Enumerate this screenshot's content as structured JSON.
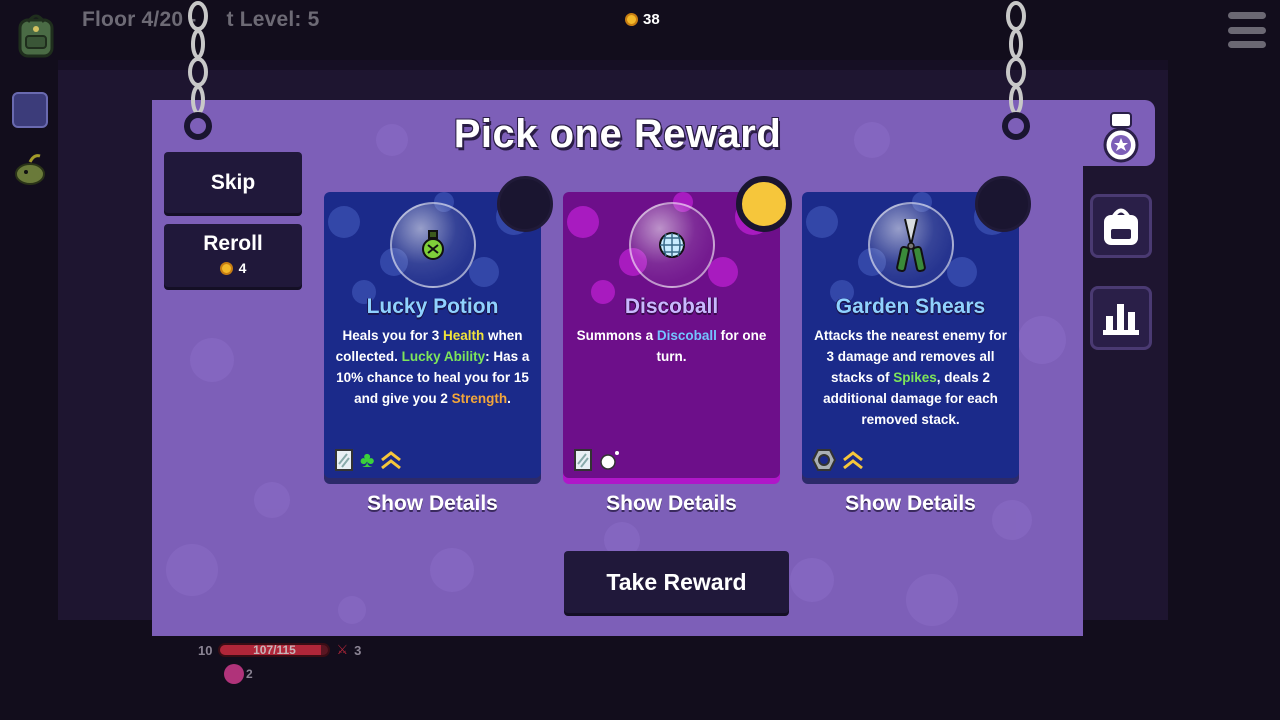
{
  "hud": {
    "floor_text": "Floor 4/20 - ",
    "level_text": "t Level: 5",
    "coins": "38",
    "hp_text": "107/115",
    "hp_fraction": 0.93,
    "shield": "10",
    "attack": "3",
    "skull_count": "2"
  },
  "panel": {
    "title": "Pick one Reward",
    "skip_label": "Skip",
    "reroll_label": "Reroll",
    "reroll_cost": "4",
    "take_label": "Take Reward"
  },
  "cards": [
    {
      "name": "Lucky Potion",
      "icon": "potion-icon",
      "rarity": "common",
      "desc_parts": [
        {
          "t": "Heals you for 3 "
        },
        {
          "t": "Health",
          "c": "kw-yellow"
        },
        {
          "t": " when collected. "
        },
        {
          "t": "Lucky Ability",
          "c": "kw-green"
        },
        {
          "t": ": Has a 10% chance to heal you for 15 and give you 2 "
        },
        {
          "t": "Strength",
          "c": "kw-orange"
        },
        {
          "t": "."
        }
      ],
      "tags": [
        "mirror-icon",
        "clover-icon",
        "chevron-up-icon"
      ],
      "details_label": "Show Details"
    },
    {
      "name": "Discoball",
      "icon": "discoball-icon",
      "rarity": "gold",
      "desc_parts": [
        {
          "t": "Summons a "
        },
        {
          "t": "Discoball",
          "c": "kw-blue"
        },
        {
          "t": " for one turn."
        }
      ],
      "tags": [
        "mirror-icon",
        "sparkle-orb-icon"
      ],
      "details_label": "Show Details"
    },
    {
      "name": "Garden Shears",
      "icon": "shears-icon",
      "rarity": "common",
      "desc_parts": [
        {
          "t": "Attacks the nearest enemy for 3 damage and removes all stacks of "
        },
        {
          "t": "Spikes",
          "c": "kw-green"
        },
        {
          "t": ", deals 2 additional damage for each removed stack."
        }
      ],
      "tags": [
        "nut-icon",
        "chevron-up-icon"
      ],
      "details_label": "Show Details"
    }
  ],
  "colors": {
    "panel": "#7d5fb8",
    "card_blue": "#1b2a8a",
    "card_magenta": "#6d0f8a",
    "button_dark": "#20183a",
    "coin": "#f3b82a",
    "rarity_gold": "#f6c63b"
  },
  "side_buttons": [
    "medal-icon",
    "backpack-icon",
    "stats-icon"
  ]
}
